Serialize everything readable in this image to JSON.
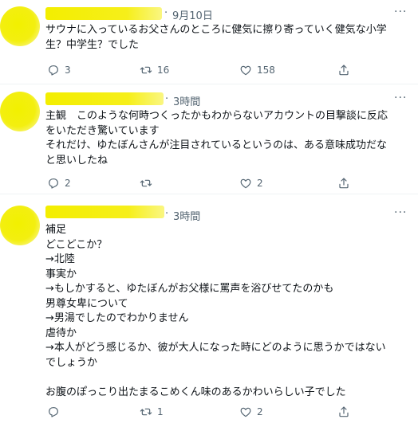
{
  "tweets": [
    {
      "time": "9月10日",
      "more_icon": "more-icon",
      "lines": [
        "サウナに入っているお父さんのところに健気に擦り寄っていく健気な小学",
        "生？中学生？でした"
      ],
      "reply_count": "3",
      "retweet_count": "16",
      "like_count": "158"
    },
    {
      "time": "3時間",
      "more_icon": "more-icon",
      "lines": [
        "主観　このような何時つくったかもわからないアカウントの目撃談に反応",
        "をいただき驚いています",
        "それだけ、ゆたぼんさんが注目されているというのは、ある意味成功だな",
        "と思いしたね"
      ],
      "reply_count": "2",
      "retweet_count": "",
      "like_count": "2"
    },
    {
      "time": "3時間",
      "more_icon": "more-icon",
      "lines": [
        "補足",
        "どこどこか？",
        "→北陸",
        "事実か",
        "→もしかすると、ゆたぼんがお父様に罵声を浴びせてたのかも",
        "男尊女卑について",
        "→男湯でしたのでわかりません",
        "虐待か",
        "→本人がどう感じるか、彼が大人になった時にどのように思うかではない",
        "でしょうか",
        "",
        "お腹のぽっこり出たまるこめくん味のあるかわいらしい子でした"
      ],
      "reply_count": "",
      "retweet_count": "1",
      "like_count": "2"
    }
  ],
  "colors": {
    "text": "#0f1419",
    "secondary": "#536471",
    "highlight": "#f3ee00",
    "divider": "#eff3f4"
  },
  "icons": [
    "reply-icon",
    "retweet-icon",
    "like-icon",
    "share-icon",
    "more-icon"
  ]
}
